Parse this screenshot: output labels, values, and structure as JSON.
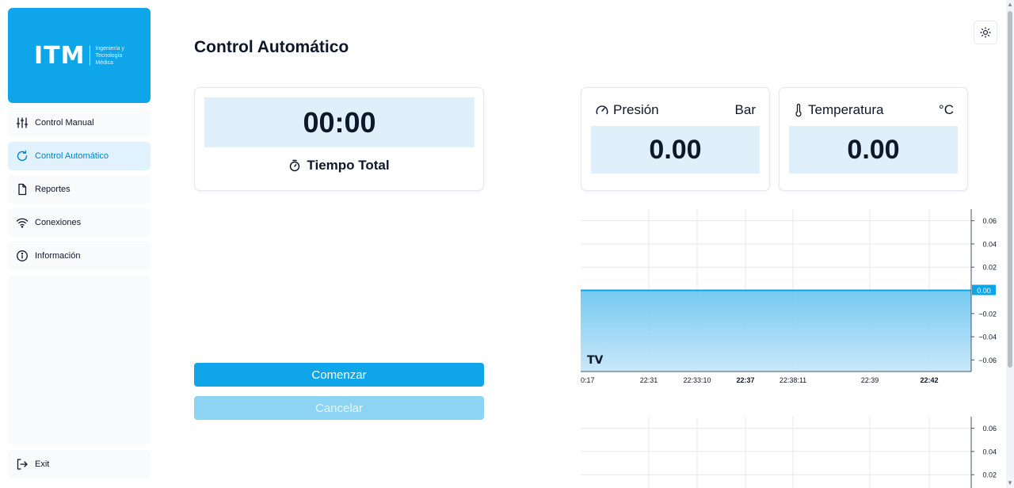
{
  "brand": {
    "mark": "ITM",
    "subtitle_lines": [
      "Ingeniería y",
      "Tecnología",
      "Médica"
    ],
    "color": "#0ea5e9"
  },
  "sidebar": {
    "items": [
      {
        "label": "Control Manual",
        "icon": "sliders-icon"
      },
      {
        "label": "Control Automático",
        "icon": "refresh-icon",
        "active": true
      },
      {
        "label": "Reportes",
        "icon": "file-icon"
      },
      {
        "label": "Conexiones",
        "icon": "wifi-icon"
      },
      {
        "label": "Información",
        "icon": "info-icon"
      }
    ],
    "exit_label": "Exit"
  },
  "page": {
    "title": "Control Automático",
    "theme_toggle_icon": "sun-icon"
  },
  "timer": {
    "value": "00:00",
    "label": "Tiempo Total"
  },
  "pressure": {
    "label": "Presión",
    "unit": "Bar",
    "value": "0.00"
  },
  "temperature": {
    "label": "Temperatura",
    "unit": "°C",
    "value": "0.00"
  },
  "buttons": {
    "start": "Comenzar",
    "cancel": "Cancelar"
  },
  "chart_data": [
    {
      "type": "area",
      "x_ticks": [
        "0:17",
        "22:31",
        "22:33:10",
        "22:37",
        "22:38:11",
        "22:39",
        "22:42"
      ],
      "x_ticks_bold": [
        "22:37",
        "22:42"
      ],
      "y_ticks": [
        "0.06",
        "0.04",
        "0.02",
        "0.00",
        "−0.02",
        "−0.04",
        "−0.06"
      ],
      "ylim": [
        -0.07,
        0.07
      ],
      "series": [
        {
          "values": [
            0,
            0,
            0,
            0,
            0,
            0,
            0
          ]
        }
      ],
      "last_value_label": "0.00",
      "grid": true,
      "colors": {
        "line": "#0ea5e9",
        "fill_top": "#6ec6f1",
        "fill_bottom": "#c6e7f9",
        "badge": "#0ea5e9"
      },
      "watermark": "TV"
    },
    {
      "type": "area",
      "y_ticks": [
        "0.06",
        "0.04",
        "0.02"
      ],
      "ylim": [
        -0.07,
        0.07
      ],
      "grid": true
    }
  ]
}
